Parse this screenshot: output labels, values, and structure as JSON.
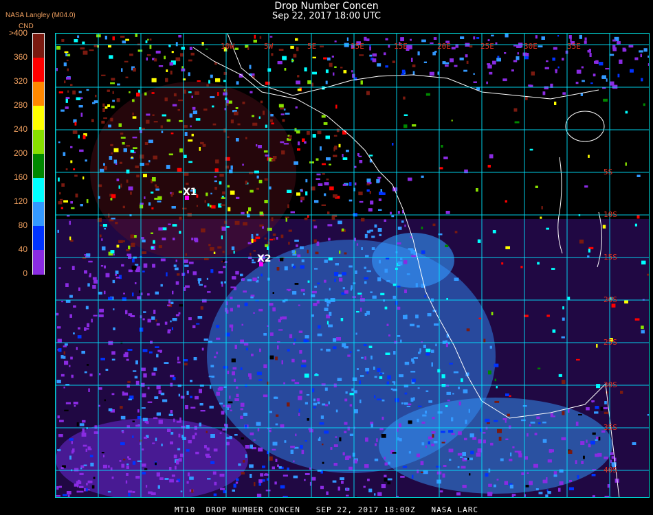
{
  "header": {
    "title": "Drop Number Concen",
    "subtitle": "Sep 22, 2017 18:00 UTC",
    "agency": "NASA Langley (M04.0)"
  },
  "colorbar": {
    "unit": "CND",
    "labels": [
      ">400",
      "360",
      "320",
      "280",
      "240",
      "200",
      "160",
      "120",
      "80",
      "40",
      "0"
    ],
    "colors": [
      "#7a1a10",
      "#ff0000",
      "#ff8800",
      "#ffff00",
      "#88e000",
      "#008800",
      "#00ffff",
      "#3399ff",
      "#0033ff",
      "#8a2be2"
    ]
  },
  "map": {
    "longitude_labels": [
      "10W",
      "5W",
      "5E",
      "15E",
      "15E",
      "20E",
      "25E",
      "30E",
      "35E"
    ],
    "latitude_labels": [
      "5S",
      "10S",
      "15S",
      "20S",
      "25S",
      "30S",
      "35S",
      "40S"
    ],
    "markers": [
      {
        "label": "X1",
        "color": "#ff00ff"
      },
      {
        "label": "X2",
        "color": "#ff00ff"
      }
    ],
    "grid_color": "#00e5ff",
    "coast_color": "#ffffff",
    "land_color": "#000000",
    "ocean_cloud_colors": [
      "#8a2be2",
      "#3399ff",
      "#0033ff",
      "#00ffff",
      "#7a1a10",
      "#ff0000",
      "#88e000",
      "#008800",
      "#ffff00"
    ]
  },
  "footer": {
    "text": "MT10  DROP NUMBER CONCEN   SEP 22, 2017 18:00Z   NASA LARC"
  }
}
